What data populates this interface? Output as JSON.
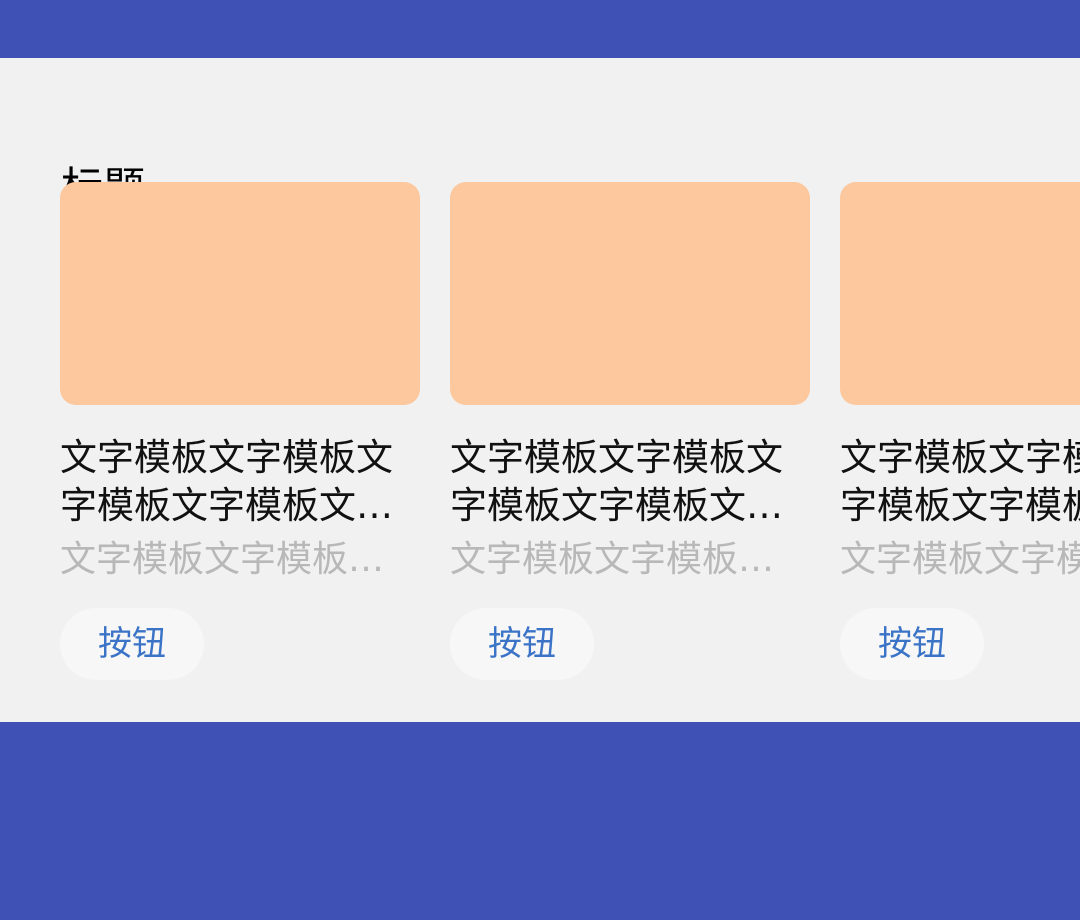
{
  "colors": {
    "frame_background": "#3f51b5",
    "panel_background": "#f1f1f1",
    "thumbnail": "#fdc89d",
    "title_text": "#111111",
    "subtitle_text": "#b8b8b8",
    "button_text": "#3b73c7",
    "button_background": "#f7f7f7"
  },
  "section": {
    "title": "标题"
  },
  "cards": [
    {
      "title": "文字模板文字模板文字模板文字模板文字模板文字模板文字模板",
      "subtitle": "文字模板文字模板文字模板文字模板",
      "button_label": "按钮"
    },
    {
      "title": "文字模板文字模板文字模板文字模板文字模板文字模板文字模板",
      "subtitle": "文字模板文字模板文字模板文字模板",
      "button_label": "按钮"
    },
    {
      "title": "文字模板文字模板文字模板文字模板文字模板文字模板文字模板",
      "subtitle": "文字模板文字模板文字模板文字模板",
      "button_label": "按钮"
    }
  ]
}
